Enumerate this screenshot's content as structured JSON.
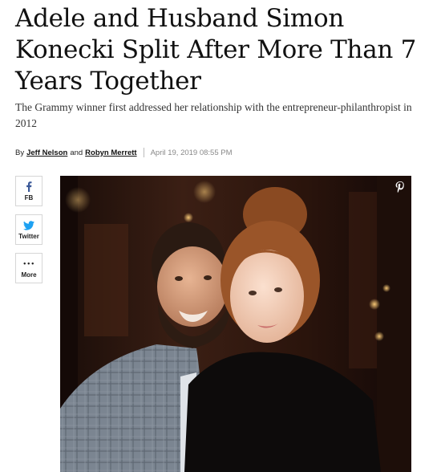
{
  "article": {
    "headline": "Adele and Husband Simon Konecki Split After More Than 7 Years Together",
    "dek": "The Grammy winner first addressed her relationship with the entrepreneur-philanthropist in 2012",
    "byline": {
      "prefix": "By",
      "author1": "Jeff Nelson",
      "conjunction": "and",
      "author2": "Robyn Merrett",
      "date": "April 19, 2019 08:55 PM"
    }
  },
  "share": {
    "facebook_label": "FB",
    "twitter_label": "Twitter",
    "more_label": "More",
    "more_glyph": "•••"
  },
  "hero": {
    "pin_icon": "pinterest-icon"
  },
  "colors": {
    "facebook": "#3b5998",
    "twitter": "#1da1f2"
  }
}
